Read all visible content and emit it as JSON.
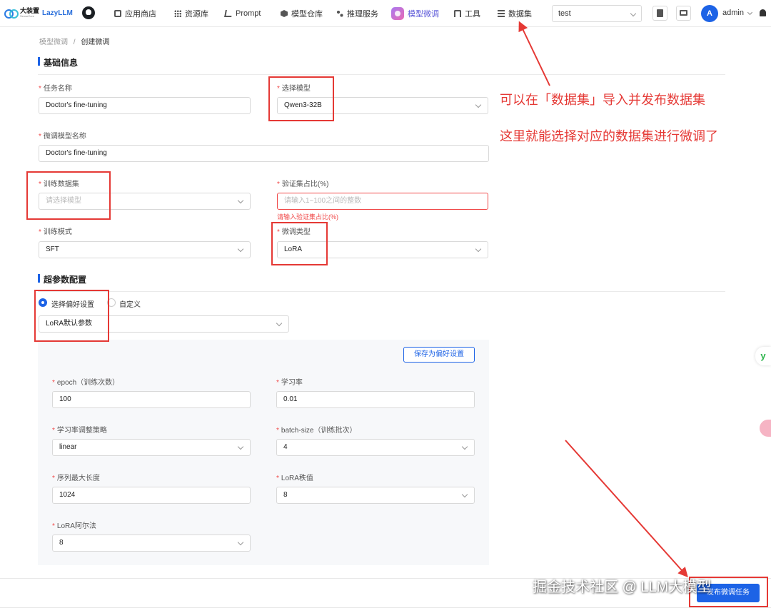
{
  "nav": {
    "logo_cn": "大装置",
    "logo_sub": "SenseCore",
    "logo_en": "LazyLLM",
    "items": [
      {
        "label": "应用商店",
        "icon": "store-icon"
      },
      {
        "label": "资源库",
        "icon": "grid-icon"
      },
      {
        "label": "Prompt",
        "icon": "prompt-icon"
      },
      {
        "label": "模型仓库",
        "icon": "hexagon-icon"
      },
      {
        "label": "推理服务",
        "icon": "flow-icon"
      },
      {
        "label": "模型微调",
        "icon": "finetune-icon",
        "active": true
      },
      {
        "label": "工具",
        "icon": "toolbox-icon"
      },
      {
        "label": "数据集",
        "icon": "database-icon"
      }
    ],
    "workspace": "test",
    "avatar_letter": "A",
    "username": "admin"
  },
  "breadcrumb": {
    "parent": "模型微调",
    "sep": "/",
    "current": "创建微调"
  },
  "basic": {
    "title": "基础信息",
    "task_name": {
      "label": "任务名称",
      "value": "Doctor's fine-tuning"
    },
    "model": {
      "label": "选择模型",
      "value": "Qwen3-32B"
    },
    "ft_model_name": {
      "label": "微调模型名称",
      "value": "Doctor's fine-tuning"
    },
    "dataset": {
      "label": "训练数据集",
      "placeholder": "请选择模型"
    },
    "val_ratio": {
      "label": "验证集占比(%)",
      "placeholder": "请输入1~100之间的整数",
      "error": "请输入验证集占比(%)"
    },
    "train_mode": {
      "label": "训练模式",
      "value": "SFT"
    },
    "ft_type": {
      "label": "微调类型",
      "value": "LoRA"
    }
  },
  "hyper": {
    "title": "超参数配置",
    "radio_pref": "选择偏好设置",
    "radio_custom": "自定义",
    "pref_value": "LoRA默认参数",
    "save_pref": "保存为偏好设置",
    "epoch": {
      "label": "epoch（训练次数）",
      "value": "100"
    },
    "lr": {
      "label": "学习率",
      "value": "0.01"
    },
    "lr_sched": {
      "label": "学习率调整策略",
      "value": "linear"
    },
    "batch": {
      "label": "batch-size（训练批次）",
      "value": "4"
    },
    "seq_len": {
      "label": "序列最大长度",
      "value": "1024"
    },
    "lora_rank": {
      "label": "LoRA秩值",
      "value": "8"
    },
    "lora_alpha": {
      "label": "LoRA阿尔法",
      "value": "8"
    }
  },
  "submit_label": "发布微调任务",
  "annotations": {
    "line1": "可以在「数据集」导入并发布数据集",
    "line2": "这里就能选择对应的数据集进行微调了"
  },
  "watermark": "掘金技术社区 @ LLM大模型",
  "colors": {
    "primary": "#1d63e6",
    "error": "#f04a4a",
    "annotation": "#e53935"
  }
}
